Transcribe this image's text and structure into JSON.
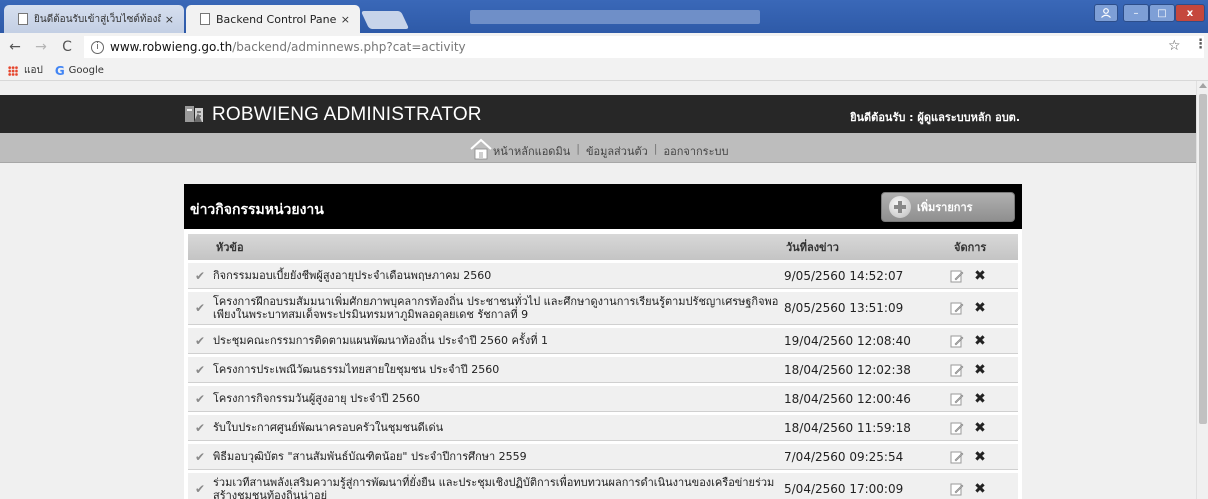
{
  "browser": {
    "tabs": [
      {
        "label": "ยินดีต้อนรับเข้าสู่เว็บไซต์ท้องถิ่",
        "close": "×"
      },
      {
        "label": "Backend Control Panel",
        "close": "×"
      }
    ],
    "window_controls": {
      "minimize": "–",
      "maximize": "□",
      "close": "x"
    },
    "url_host": "www.robwieng.go.th",
    "url_path": "/backend/adminnews.php?cat=activity",
    "bookmarks": [
      {
        "label": "แอป",
        "icon": "apps-grid-icon"
      },
      {
        "label": "Google",
        "icon": "google-icon"
      }
    ]
  },
  "header": {
    "brand": "ROBWIENG ADMINISTRATOR",
    "welcome": "ยินดีต้อนรับ :  ผู้ดูแลระบบหลัก อบต."
  },
  "menu": {
    "home": "หน้าหลักแอดมิน",
    "profile": "ข้อมูลส่วนตัว",
    "logout": "ออกจากระบบ",
    "separator": "|"
  },
  "panel": {
    "title": "ข่าวกิจกรรมหน่วยงาน",
    "add_label": "เพิ่มรายการ"
  },
  "table": {
    "headers": {
      "title": "หัวข้อ",
      "date": "วันที่ลงข่าว",
      "manage": "จัดการ"
    },
    "rows": [
      {
        "title": "กิจกรรมมอบเบี้ยยังชีพผู้สูงอายุประจำเดือนพฤษภาคม 2560",
        "date": "9/05/2560 14:52:07"
      },
      {
        "title": "โครงการฝึกอบรมสัมมนาเพิ่มศักยภาพบุคลากรท้องถิ่น ประชาชนทั่วไป และศึกษาดูงานการเรียนรู้ตามปรัชญาเศรษฐกิจพอเพียงในพระบาทสมเด็จพระปรมินทรมหาภูมิพลอดุลยเดช รัชกาลที่ 9",
        "date": "8/05/2560 13:51:09"
      },
      {
        "title": "ประชุมคณะกรรมการติดตามแผนพัฒนาท้องถิ่น ประจำปี 2560 ครั้งที่ 1",
        "date": "19/04/2560 12:08:40"
      },
      {
        "title": "โครงการประเพณีวัฒนธรรมไทยสายใยชุมชน ประจำปี 2560",
        "date": "18/04/2560 12:02:38"
      },
      {
        "title": "โครงการกิจกรรมวันผู้สูงอายุ ประจำปี 2560",
        "date": "18/04/2560 12:00:46"
      },
      {
        "title": "รับใบประกาศศูนย์พัฒนาครอบครัวในชุมชนดีเด่น",
        "date": "18/04/2560 11:59:18"
      },
      {
        "title": "พิธีมอบวุฒิบัตร \"สานสัมพันธ์บัณฑิตน้อย\" ประจำปีการศึกษา 2559",
        "date": "7/04/2560 09:25:54"
      },
      {
        "title": "ร่วมเวทีสานพลังเสริมความรู้สู่การพัฒนาที่ยั่งยืน และประชุมเชิงปฏิบัติการเพื่อทบทวนผลการดำเนินงานของเครือข่ายร่วมสร้างชุมชนท้องถิ่นน่าอยู่",
        "date": "5/04/2560 17:00:09"
      }
    ],
    "check_glyph": "✔",
    "delete_glyph": "✖"
  }
}
